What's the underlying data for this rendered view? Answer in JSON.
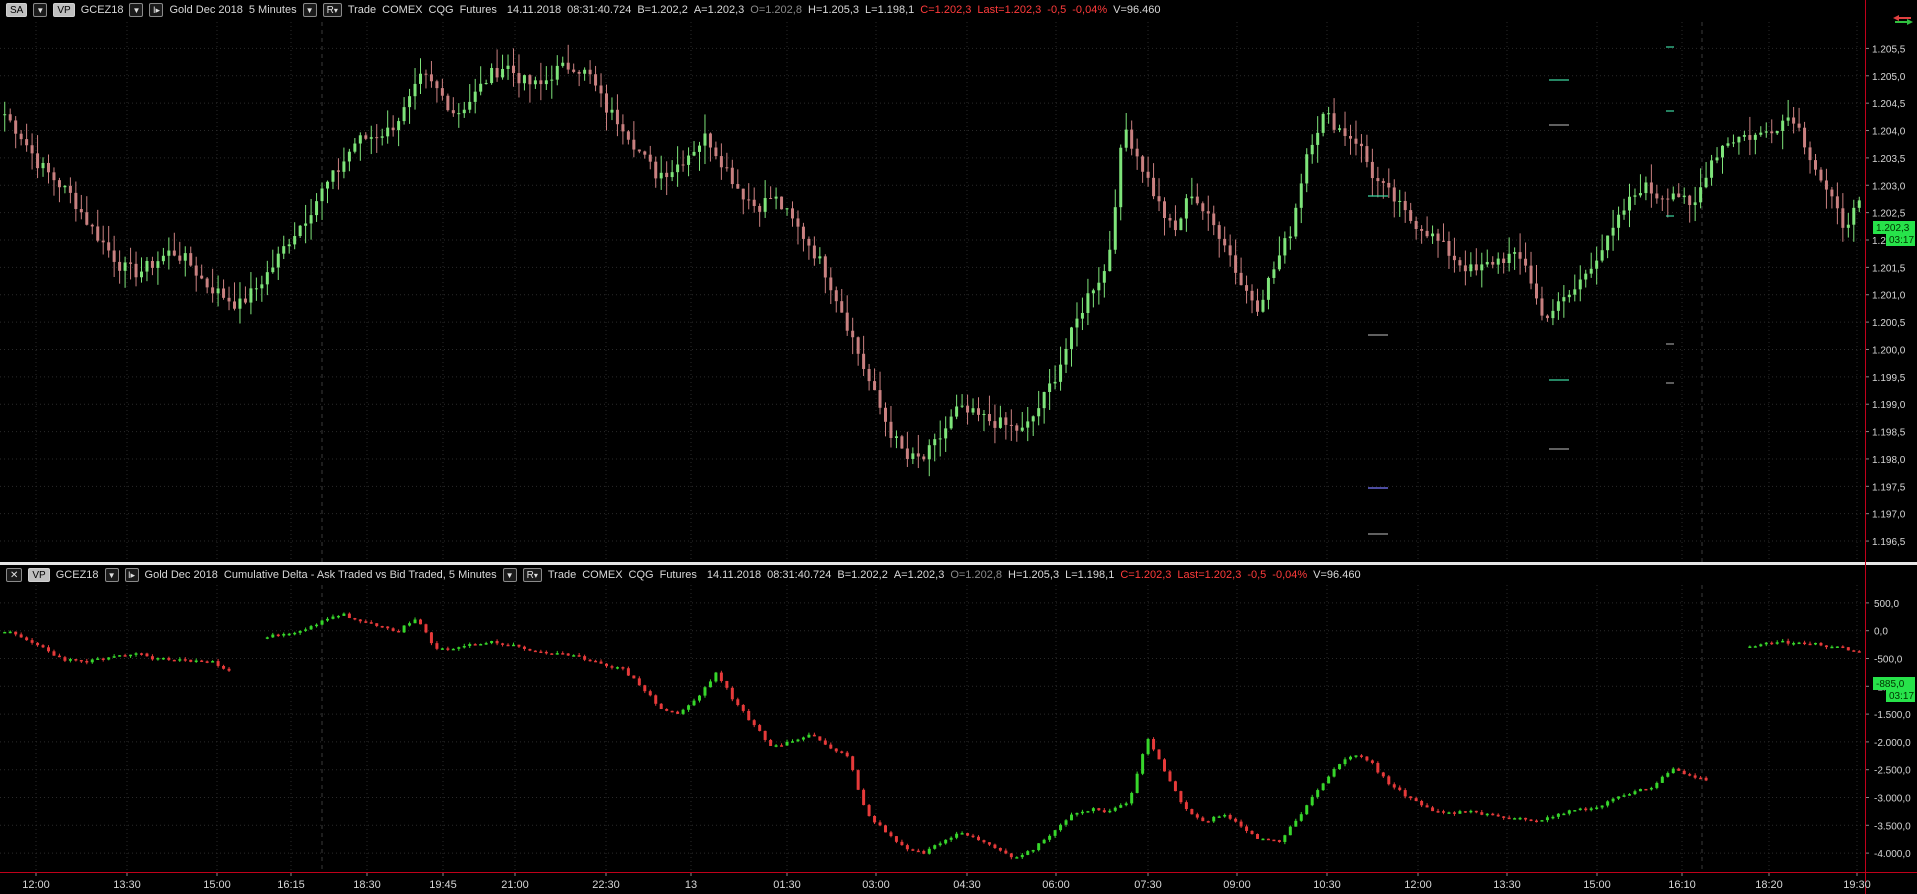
{
  "top_header": {
    "sa_label": "SA",
    "vp_label": "VP",
    "symbol": "GCEZ18",
    "r_label": "R",
    "instrument": "Gold Dec 2018",
    "interval": "5 Minutes",
    "trade": "Trade",
    "exchange": "COMEX",
    "feed": "CQG",
    "type": "Futures",
    "datetime": "14.11.2018",
    "clock": "08:31:40.724",
    "bid": "B=1.202,2",
    "ask": "A=1.202,3",
    "open": "O=1.202,8",
    "high": "H=1.205,3",
    "low": "L=1.198,1",
    "close": "C=1.202,3",
    "last": "Last=1.202,3",
    "change": "-0,5",
    "change_pct": "-0,04%",
    "volume": "V=96.460"
  },
  "bottom_header": {
    "close_label": "✕",
    "vp_label": "VP",
    "symbol": "GCEZ18",
    "r_label": "R",
    "instrument": "Gold Dec 2018",
    "study": "Cumulative Delta - Ask Traded vs Bid Traded, 5 Minutes",
    "trade": "Trade",
    "exchange": "COMEX",
    "feed": "CQG",
    "type": "Futures",
    "datetime": "14.11.2018",
    "clock": "08:31:40.724",
    "bid": "B=1.202,2",
    "ask": "A=1.202,3",
    "open": "O=1.202,8",
    "high": "H=1.205,3",
    "low": "L=1.198,1",
    "close": "C=1.202,3",
    "last": "Last=1.202,3",
    "change": "-0,5",
    "change_pct": "-0,04%",
    "volume": "V=96.460"
  },
  "price_axis": [
    "1.205,5",
    "1.205,0",
    "1.204,5",
    "1.204,0",
    "1.203,5",
    "1.203,0",
    "1.202,5",
    "1.202,0",
    "1.201,5",
    "1.201,0",
    "1.200,5",
    "1.200,0",
    "1.199,5",
    "1.199,0",
    "1.198,5",
    "1.198,0",
    "1.197,5",
    "1.197,0",
    "1.196,5"
  ],
  "price_flag": {
    "value": "1.202,3",
    "timer": "03:17"
  },
  "delta_axis": [
    "500,0",
    "0,0",
    "-500,0",
    "-1.000,0",
    "-1.500,0",
    "-2.000,0",
    "-2.500,0",
    "-3.000,0",
    "-3.500,0",
    "-4.000,0"
  ],
  "delta_flag": {
    "value": "-885,0",
    "timer": "03:17"
  },
  "time_axis": [
    "12:00",
    "13:30",
    "15:00",
    "16:15",
    "18:30",
    "19:45",
    "21:00",
    "22:30",
    "13",
    "01:30",
    "03:00",
    "04:30",
    "06:00",
    "07:30",
    "09:00",
    "10:30",
    "12:00",
    "13:30",
    "15:00",
    "16:10",
    "18:20",
    "19:30"
  ],
  "colors": {
    "up": "#37d62b",
    "down": "#e63a3a",
    "price_up": "#7ee47a",
    "price_down": "#c98080",
    "flag": "#27e34a",
    "grid": "#2a2a2a",
    "accent_red": "#c0001a"
  },
  "chart_data": [
    {
      "type": "candlestick",
      "title": "Gold Dec 2018 5 Minutes",
      "ylim": [
        1196.3,
        1205.8
      ],
      "close_path": [
        1204.3,
        1203.9,
        1203.4,
        1203.1,
        1202.8,
        1202.3,
        1201.9,
        1201.5,
        1201.4,
        1201.6,
        1201.8,
        1201.6,
        1201.2,
        1201.0,
        1200.8,
        1201.1,
        1201.5,
        1202.0,
        1202.4,
        1202.9,
        1203.3,
        1203.8,
        1203.9,
        1204.0,
        1204.4,
        1205.0,
        1204.7,
        1204.3,
        1204.6,
        1205.0,
        1205.2,
        1204.9,
        1204.8,
        1205.1,
        1205.2,
        1205.0,
        1204.4,
        1204.1,
        1203.6,
        1203.2,
        1203.3,
        1203.6,
        1203.9,
        1203.4,
        1202.9,
        1202.6,
        1202.8,
        1202.4,
        1202.0,
        1201.5,
        1200.8,
        1200.0,
        1199.2,
        1198.5,
        1198.0,
        1198.0,
        1198.4,
        1198.9,
        1198.8,
        1198.7,
        1198.6,
        1198.5,
        1199.0,
        1199.6,
        1200.4,
        1201.1,
        1201.5,
        1204.1,
        1203.4,
        1202.7,
        1202.1,
        1202.9,
        1202.4,
        1202.0,
        1201.2,
        1200.8,
        1201.5,
        1202.2,
        1203.7,
        1204.3,
        1204.0,
        1203.8,
        1203.1,
        1202.8,
        1202.4,
        1202.2,
        1201.9,
        1201.6,
        1201.4,
        1201.6,
        1201.7,
        1201.6,
        1200.6,
        1200.8,
        1201.1,
        1201.6,
        1202.0,
        1202.6,
        1203.0,
        1202.8,
        1202.9,
        1202.5,
        1203.4,
        1203.8,
        1203.9,
        1203.9,
        1204.1,
        1204.3,
        1203.6,
        1202.9,
        1202.3,
        1202.6
      ]
    },
    {
      "type": "candlestick",
      "title": "Cumulative Delta - Ask Traded vs Bid Traded, 5 Minutes",
      "ylim": [
        -4250,
        750
      ],
      "close_path": [
        0,
        -150,
        -300,
        -500,
        -560,
        -520,
        -480,
        -400,
        -500,
        -520,
        -540,
        -560,
        -700,
        null,
        -100,
        -80,
        0,
        200,
        300,
        150,
        80,
        -10,
        220,
        -350,
        -300,
        -250,
        -200,
        -260,
        -350,
        -400,
        -450,
        -500,
        -600,
        -700,
        -1000,
        -1400,
        -1500,
        -1200,
        -750,
        -1300,
        -1700,
        -2100,
        -2000,
        -1850,
        -2100,
        -2250,
        -3300,
        -3600,
        -3900,
        -4000,
        -3800,
        -3600,
        -3750,
        -3900,
        -4100,
        -3900,
        -3600,
        -3300,
        -3200,
        -3250,
        -3100,
        -1900,
        -2600,
        -3200,
        -3450,
        -3300,
        -3500,
        -3750,
        -3800,
        -3400,
        -2900,
        -2500,
        -2200,
        -2400,
        -2800,
        -3000,
        -3200,
        -3300,
        -3250,
        -3300,
        -3350,
        -3400,
        -3400,
        -3300,
        -3200,
        -3200,
        -3000,
        -2900,
        -2800,
        -2500,
        -2600,
        -2700,
        null,
        -300,
        -200,
        -200,
        -220,
        -260,
        -300,
        -400
      ]
    }
  ]
}
